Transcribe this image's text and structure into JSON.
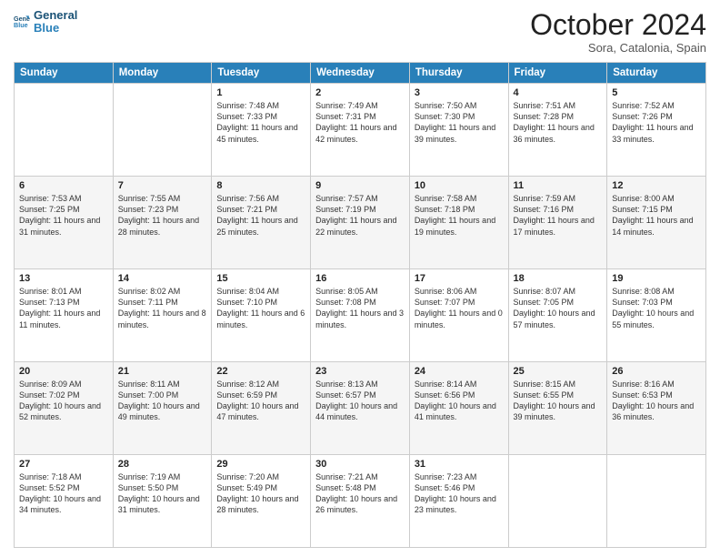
{
  "header": {
    "logo_line1": "General",
    "logo_line2": "Blue",
    "month": "October 2024",
    "location": "Sora, Catalonia, Spain"
  },
  "weekdays": [
    "Sunday",
    "Monday",
    "Tuesday",
    "Wednesday",
    "Thursday",
    "Friday",
    "Saturday"
  ],
  "weeks": [
    [
      {
        "day": "",
        "sunrise": "",
        "sunset": "",
        "daylight": ""
      },
      {
        "day": "",
        "sunrise": "",
        "sunset": "",
        "daylight": ""
      },
      {
        "day": "1",
        "sunrise": "Sunrise: 7:48 AM",
        "sunset": "Sunset: 7:33 PM",
        "daylight": "Daylight: 11 hours and 45 minutes."
      },
      {
        "day": "2",
        "sunrise": "Sunrise: 7:49 AM",
        "sunset": "Sunset: 7:31 PM",
        "daylight": "Daylight: 11 hours and 42 minutes."
      },
      {
        "day": "3",
        "sunrise": "Sunrise: 7:50 AM",
        "sunset": "Sunset: 7:30 PM",
        "daylight": "Daylight: 11 hours and 39 minutes."
      },
      {
        "day": "4",
        "sunrise": "Sunrise: 7:51 AM",
        "sunset": "Sunset: 7:28 PM",
        "daylight": "Daylight: 11 hours and 36 minutes."
      },
      {
        "day": "5",
        "sunrise": "Sunrise: 7:52 AM",
        "sunset": "Sunset: 7:26 PM",
        "daylight": "Daylight: 11 hours and 33 minutes."
      }
    ],
    [
      {
        "day": "6",
        "sunrise": "Sunrise: 7:53 AM",
        "sunset": "Sunset: 7:25 PM",
        "daylight": "Daylight: 11 hours and 31 minutes."
      },
      {
        "day": "7",
        "sunrise": "Sunrise: 7:55 AM",
        "sunset": "Sunset: 7:23 PM",
        "daylight": "Daylight: 11 hours and 28 minutes."
      },
      {
        "day": "8",
        "sunrise": "Sunrise: 7:56 AM",
        "sunset": "Sunset: 7:21 PM",
        "daylight": "Daylight: 11 hours and 25 minutes."
      },
      {
        "day": "9",
        "sunrise": "Sunrise: 7:57 AM",
        "sunset": "Sunset: 7:19 PM",
        "daylight": "Daylight: 11 hours and 22 minutes."
      },
      {
        "day": "10",
        "sunrise": "Sunrise: 7:58 AM",
        "sunset": "Sunset: 7:18 PM",
        "daylight": "Daylight: 11 hours and 19 minutes."
      },
      {
        "day": "11",
        "sunrise": "Sunrise: 7:59 AM",
        "sunset": "Sunset: 7:16 PM",
        "daylight": "Daylight: 11 hours and 17 minutes."
      },
      {
        "day": "12",
        "sunrise": "Sunrise: 8:00 AM",
        "sunset": "Sunset: 7:15 PM",
        "daylight": "Daylight: 11 hours and 14 minutes."
      }
    ],
    [
      {
        "day": "13",
        "sunrise": "Sunrise: 8:01 AM",
        "sunset": "Sunset: 7:13 PM",
        "daylight": "Daylight: 11 hours and 11 minutes."
      },
      {
        "day": "14",
        "sunrise": "Sunrise: 8:02 AM",
        "sunset": "Sunset: 7:11 PM",
        "daylight": "Daylight: 11 hours and 8 minutes."
      },
      {
        "day": "15",
        "sunrise": "Sunrise: 8:04 AM",
        "sunset": "Sunset: 7:10 PM",
        "daylight": "Daylight: 11 hours and 6 minutes."
      },
      {
        "day": "16",
        "sunrise": "Sunrise: 8:05 AM",
        "sunset": "Sunset: 7:08 PM",
        "daylight": "Daylight: 11 hours and 3 minutes."
      },
      {
        "day": "17",
        "sunrise": "Sunrise: 8:06 AM",
        "sunset": "Sunset: 7:07 PM",
        "daylight": "Daylight: 11 hours and 0 minutes."
      },
      {
        "day": "18",
        "sunrise": "Sunrise: 8:07 AM",
        "sunset": "Sunset: 7:05 PM",
        "daylight": "Daylight: 10 hours and 57 minutes."
      },
      {
        "day": "19",
        "sunrise": "Sunrise: 8:08 AM",
        "sunset": "Sunset: 7:03 PM",
        "daylight": "Daylight: 10 hours and 55 minutes."
      }
    ],
    [
      {
        "day": "20",
        "sunrise": "Sunrise: 8:09 AM",
        "sunset": "Sunset: 7:02 PM",
        "daylight": "Daylight: 10 hours and 52 minutes."
      },
      {
        "day": "21",
        "sunrise": "Sunrise: 8:11 AM",
        "sunset": "Sunset: 7:00 PM",
        "daylight": "Daylight: 10 hours and 49 minutes."
      },
      {
        "day": "22",
        "sunrise": "Sunrise: 8:12 AM",
        "sunset": "Sunset: 6:59 PM",
        "daylight": "Daylight: 10 hours and 47 minutes."
      },
      {
        "day": "23",
        "sunrise": "Sunrise: 8:13 AM",
        "sunset": "Sunset: 6:57 PM",
        "daylight": "Daylight: 10 hours and 44 minutes."
      },
      {
        "day": "24",
        "sunrise": "Sunrise: 8:14 AM",
        "sunset": "Sunset: 6:56 PM",
        "daylight": "Daylight: 10 hours and 41 minutes."
      },
      {
        "day": "25",
        "sunrise": "Sunrise: 8:15 AM",
        "sunset": "Sunset: 6:55 PM",
        "daylight": "Daylight: 10 hours and 39 minutes."
      },
      {
        "day": "26",
        "sunrise": "Sunrise: 8:16 AM",
        "sunset": "Sunset: 6:53 PM",
        "daylight": "Daylight: 10 hours and 36 minutes."
      }
    ],
    [
      {
        "day": "27",
        "sunrise": "Sunrise: 7:18 AM",
        "sunset": "Sunset: 5:52 PM",
        "daylight": "Daylight: 10 hours and 34 minutes."
      },
      {
        "day": "28",
        "sunrise": "Sunrise: 7:19 AM",
        "sunset": "Sunset: 5:50 PM",
        "daylight": "Daylight: 10 hours and 31 minutes."
      },
      {
        "day": "29",
        "sunrise": "Sunrise: 7:20 AM",
        "sunset": "Sunset: 5:49 PM",
        "daylight": "Daylight: 10 hours and 28 minutes."
      },
      {
        "day": "30",
        "sunrise": "Sunrise: 7:21 AM",
        "sunset": "Sunset: 5:48 PM",
        "daylight": "Daylight: 10 hours and 26 minutes."
      },
      {
        "day": "31",
        "sunrise": "Sunrise: 7:23 AM",
        "sunset": "Sunset: 5:46 PM",
        "daylight": "Daylight: 10 hours and 23 minutes."
      },
      {
        "day": "",
        "sunrise": "",
        "sunset": "",
        "daylight": ""
      },
      {
        "day": "",
        "sunrise": "",
        "sunset": "",
        "daylight": ""
      }
    ]
  ]
}
